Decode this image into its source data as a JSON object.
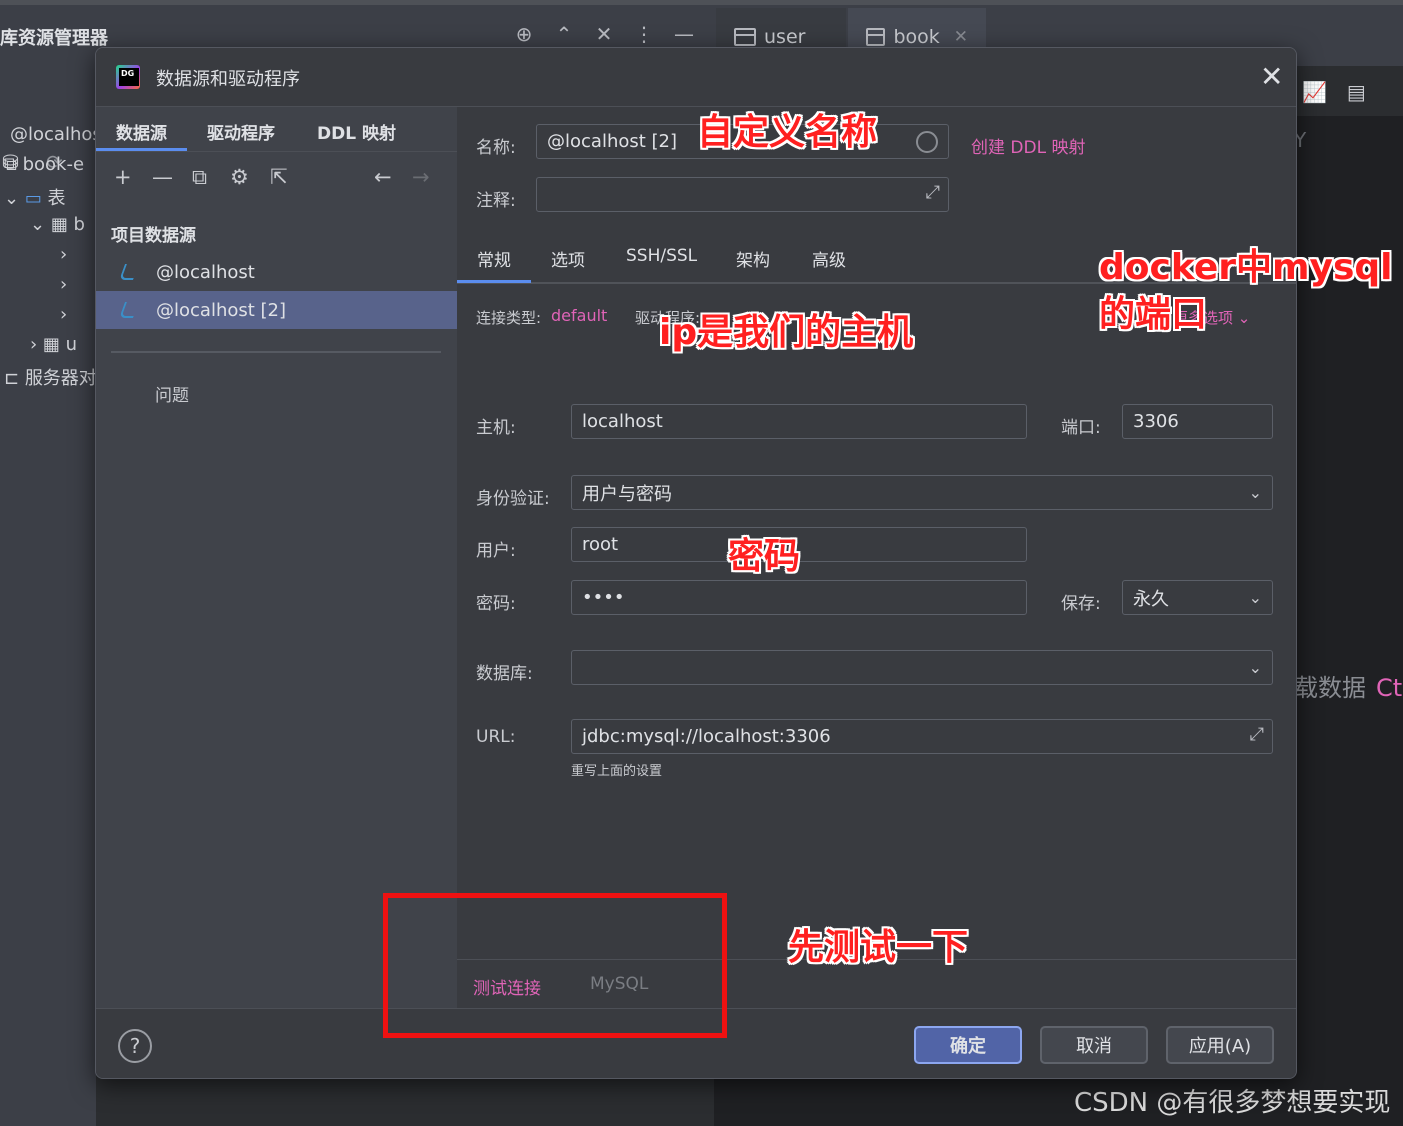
{
  "background": {
    "explorer_title": "库资源管理器",
    "top_icons": [
      "crosshair-icon",
      "expand-icon",
      "collapse-icon",
      "more-icon",
      "minimize-icon"
    ],
    "editor_tabs": [
      {
        "label": "user"
      },
      {
        "label": "book"
      }
    ],
    "tree": [
      "@localhos",
      "book-e",
      "表",
      "b",
      "u",
      "服务器对"
    ],
    "right_partial_y": "Y",
    "partial_load_text": "载数据",
    "partial_shortcut": "Ct",
    "watermark": "CSDN @有很多梦想要实现"
  },
  "dialog": {
    "title": "数据源和驱动程序",
    "sidebar": {
      "tabs": [
        "数据源",
        "驱动程序",
        "DDL 映射"
      ],
      "section_title": "项目数据源",
      "items": [
        {
          "label": "@localhost",
          "selected": false
        },
        {
          "label": "@localhost [2]",
          "selected": true
        }
      ],
      "problems": "问题"
    },
    "form": {
      "name_label": "名称:",
      "name_value": "@localhost [2]",
      "create_ddl_link": "创建 DDL 映射",
      "comment_label": "注释:",
      "comment_value": "",
      "tabs": [
        "常规",
        "选项",
        "SSH/SSL",
        "架构",
        "高级"
      ],
      "active_tab": "常规",
      "conn_type_label": "连接类型:",
      "conn_type_value": "default",
      "driver_label": "驱动程序:",
      "more_options": "更多选项",
      "host_label": "主机:",
      "host_value": "localhost",
      "port_label": "端口:",
      "port_value": "3306",
      "auth_label": "身份验证:",
      "auth_value": "用户与密码",
      "user_label": "用户:",
      "user_value": "root",
      "password_label": "密码:",
      "password_value": "••••",
      "save_label": "保存:",
      "save_value": "永久",
      "database_label": "数据库:",
      "database_value": "",
      "url_label": "URL:",
      "url_value": "jdbc:mysql://localhost:3306",
      "url_hint": "重写上面的设置",
      "test_connection": "测试连接",
      "driver_name": "MySQL"
    },
    "buttons": {
      "ok": "确定",
      "cancel": "取消",
      "apply": "应用(A)",
      "help": "?"
    }
  },
  "annotations": {
    "custom_name": "自定义名称",
    "docker_port_1": "docker中mysql",
    "docker_port_2": "的端口",
    "ip_host": "ip是我们的主机",
    "password": "密码",
    "test_first": "先测试一下",
    "color": "#ff2020"
  }
}
